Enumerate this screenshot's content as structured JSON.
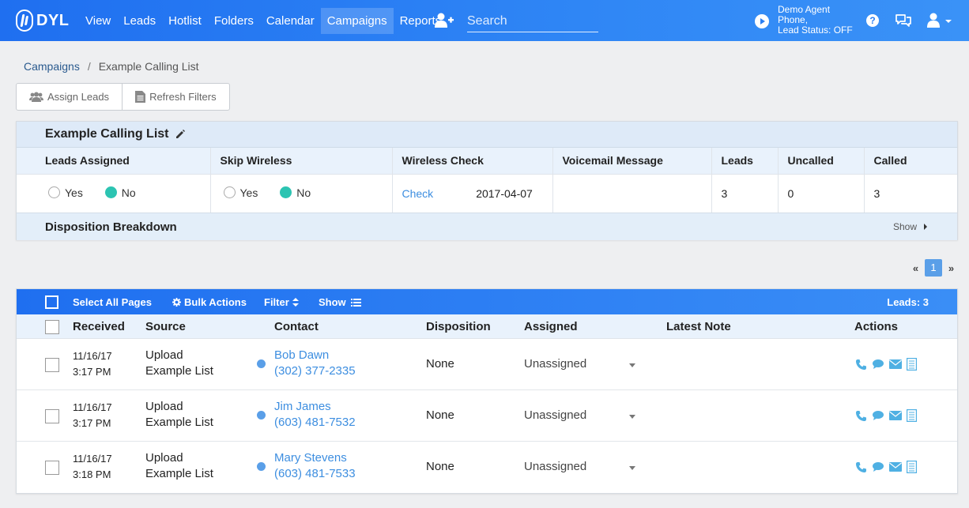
{
  "nav": {
    "brand": "DYL",
    "items": [
      {
        "label": "View",
        "active": false
      },
      {
        "label": "Leads",
        "active": false
      },
      {
        "label": "Hotlist",
        "active": false
      },
      {
        "label": "Folders",
        "active": false
      },
      {
        "label": "Calendar",
        "active": false
      },
      {
        "label": "Campaigns",
        "active": true
      },
      {
        "label": "Reports",
        "active": false
      }
    ],
    "search_placeholder": "Search",
    "agent_name": "Demo Agent",
    "agent_phone": "Phone,",
    "lead_status": "Lead Status: OFF"
  },
  "breadcrumb": {
    "parent": "Campaigns",
    "separator": "/",
    "current": "Example Calling List"
  },
  "buttons": {
    "assign_leads": "Assign Leads",
    "refresh_filters": "Refresh Filters"
  },
  "summary": {
    "title": "Example Calling List",
    "headers": {
      "leads_assigned": "Leads Assigned",
      "skip_wireless": "Skip Wireless",
      "wireless_check": "Wireless Check",
      "voicemail": "Voicemail Message",
      "leads": "Leads",
      "uncalled": "Uncalled",
      "called": "Called"
    },
    "yes_label": "Yes",
    "no_label": "No",
    "leads_assigned_value": "No",
    "skip_wireless_value": "No",
    "check_link": "Check",
    "check_date": "2017-04-07",
    "voicemail_value": "",
    "leads_value": "3",
    "uncalled_value": "0",
    "called_value": "3",
    "disposition_label": "Disposition Breakdown",
    "show_label": "Show"
  },
  "pager": {
    "prev": "«",
    "current": "1",
    "next": "»"
  },
  "leads_table": {
    "toolbar": {
      "select_all": "Select All Pages",
      "bulk_actions": "Bulk Actions",
      "filter": "Filter",
      "show": "Show",
      "leads_count": "Leads: 3"
    },
    "columns": {
      "received": "Received",
      "source": "Source",
      "contact": "Contact",
      "disposition": "Disposition",
      "assigned": "Assigned",
      "latest_note": "Latest Note",
      "actions": "Actions"
    },
    "rows": [
      {
        "date": "11/16/17",
        "time": "3:17 PM",
        "source1": "Upload",
        "source2": "Example List",
        "name": "Bob Dawn",
        "phone": "(302) 377-2335",
        "disposition": "None",
        "assigned": "Unassigned",
        "note": ""
      },
      {
        "date": "11/16/17",
        "time": "3:17 PM",
        "source1": "Upload",
        "source2": "Example List",
        "name": "Jim James",
        "phone": "(603) 481-7532",
        "disposition": "None",
        "assigned": "Unassigned",
        "note": ""
      },
      {
        "date": "11/16/17",
        "time": "3:18 PM",
        "source1": "Upload",
        "source2": "Example List",
        "name": "Mary Stevens",
        "phone": "(603) 481-7533",
        "disposition": "None",
        "assigned": "Unassigned",
        "note": ""
      }
    ]
  },
  "colors": {
    "nav_blue": "#1f6ff0",
    "accent_teal": "#2cc4b2",
    "link_blue": "#3d8ee0",
    "header_bg": "#e9f2fc"
  }
}
